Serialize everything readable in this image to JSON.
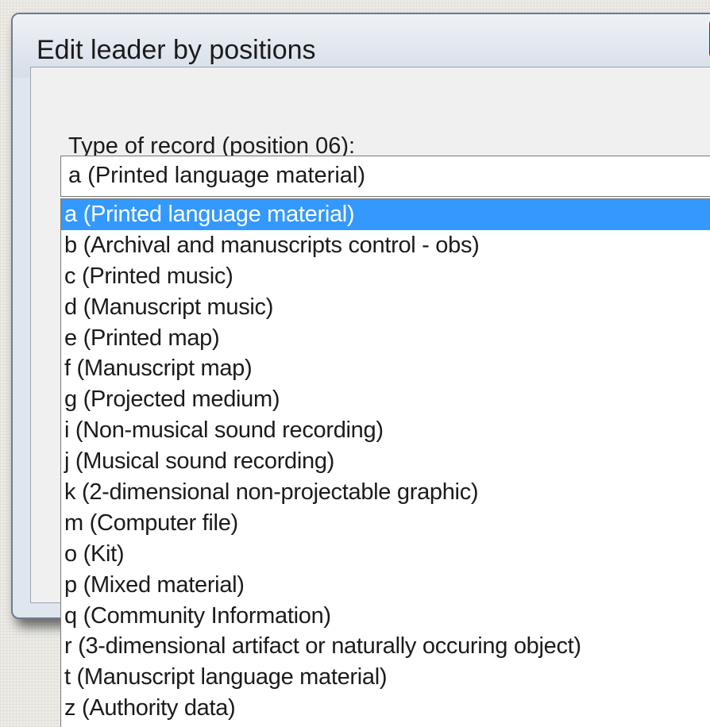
{
  "dialog": {
    "title": "Edit leader by positions"
  },
  "field": {
    "label": "Type of record (position 06):",
    "selected_value": "a (Printed language material)"
  },
  "dropdown": {
    "highlighted_index": 0,
    "options": [
      "a (Printed language material)",
      "b (Archival and manuscripts control - obs)",
      "c (Printed music)",
      "d (Manuscript music)",
      "e (Printed map)",
      "f (Manuscript map)",
      "g (Projected medium)",
      "i (Non-musical sound recording)",
      "j (Musical sound recording)",
      "k (2-dimensional non-projectable graphic)",
      "m (Computer file)",
      "o (Kit)",
      "p (Mixed material)",
      "q (Community Information)",
      "r (3-dimensional artifact or naturally occuring object)",
      "t (Manuscript language material)",
      "z (Authority data)"
    ]
  },
  "colors": {
    "highlight": "#3399ff",
    "close_button": "#c0392b"
  }
}
